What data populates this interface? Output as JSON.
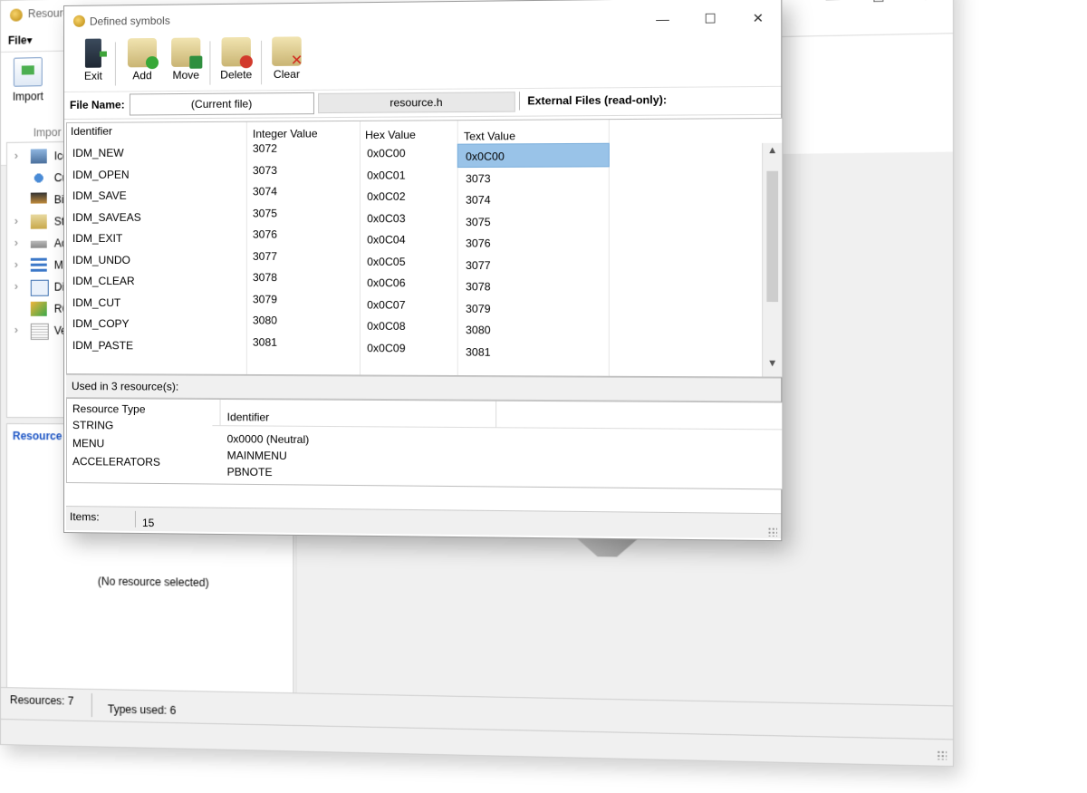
{
  "main": {
    "title": "Resourc",
    "file_menu": "File▾",
    "import_label": "Import",
    "import_group": "Impor",
    "window_controls": {
      "minimize": "—",
      "maximize": "☐",
      "close": "✕"
    },
    "tree_items": [
      {
        "label": "Ico",
        "expandable": true,
        "icon": "icon-resource-icon"
      },
      {
        "label": "Cu",
        "expandable": false,
        "icon": "cursor-icon"
      },
      {
        "label": "Bit",
        "expandable": false,
        "icon": "bitmap-icon"
      },
      {
        "label": "Str",
        "expandable": true,
        "icon": "string-icon"
      },
      {
        "label": "Ac",
        "expandable": true,
        "icon": "accelerator-icon"
      },
      {
        "label": "M",
        "expandable": true,
        "icon": "menu-icon"
      },
      {
        "label": "Di",
        "expandable": true,
        "icon": "dialog-icon"
      },
      {
        "label": "RC",
        "expandable": false,
        "icon": "rcdata-icon"
      },
      {
        "label": "Ve",
        "expandable": true,
        "icon": "version-icon"
      }
    ],
    "resource_panel_tab": "Resource P",
    "no_resource": "(No resource selected)",
    "status_resources": "Resources: 7",
    "status_types": "Types used: 6"
  },
  "dialog": {
    "title": "Defined symbols",
    "window_controls": {
      "minimize": "—",
      "maximize": "☐",
      "close": "✕"
    },
    "toolbar": {
      "exit": "Exit",
      "add": "Add",
      "move": "Move",
      "delete": "Delete",
      "clear": "Clear"
    },
    "file_name_label": "File Name:",
    "current_file": "(Current file)",
    "resource_h": "resource.h",
    "external_files": "External Files (read-only):",
    "columns": {
      "identifier": "Identifier",
      "integer": "Integer Value",
      "hex": "Hex Value",
      "text": "Text Value"
    },
    "symbols": [
      {
        "id": "IDM_NEW",
        "int": "3072",
        "hex": "0x0C00",
        "text": "0x0C00"
      },
      {
        "id": "IDM_OPEN",
        "int": "3073",
        "hex": "0x0C01",
        "text": "3073"
      },
      {
        "id": "IDM_SAVE",
        "int": "3074",
        "hex": "0x0C02",
        "text": "3074"
      },
      {
        "id": "IDM_SAVEAS",
        "int": "3075",
        "hex": "0x0C03",
        "text": "3075"
      },
      {
        "id": "IDM_EXIT",
        "int": "3076",
        "hex": "0x0C04",
        "text": "3076"
      },
      {
        "id": "IDM_UNDO",
        "int": "3077",
        "hex": "0x0C05",
        "text": "3077"
      },
      {
        "id": "IDM_CLEAR",
        "int": "3078",
        "hex": "0x0C06",
        "text": "3078"
      },
      {
        "id": "IDM_CUT",
        "int": "3079",
        "hex": "0x0C07",
        "text": "3079"
      },
      {
        "id": "IDM_COPY",
        "int": "3080",
        "hex": "0x0C08",
        "text": "3080"
      },
      {
        "id": "IDM_PASTE",
        "int": "3081",
        "hex": "0x0C09",
        "text": "3081"
      }
    ],
    "used_in": "Used in 3 resource(s):",
    "res_columns": {
      "type": "Resource Type",
      "identifier": "Identifier"
    },
    "resources": [
      {
        "type": "STRING",
        "identifier": "0x0000 (Neutral)"
      },
      {
        "type": "MENU",
        "identifier": "MAINMENU"
      },
      {
        "type": "ACCELERATORS",
        "identifier": "PBNOTE"
      }
    ],
    "items_label": "Items:",
    "items_count": "15"
  }
}
